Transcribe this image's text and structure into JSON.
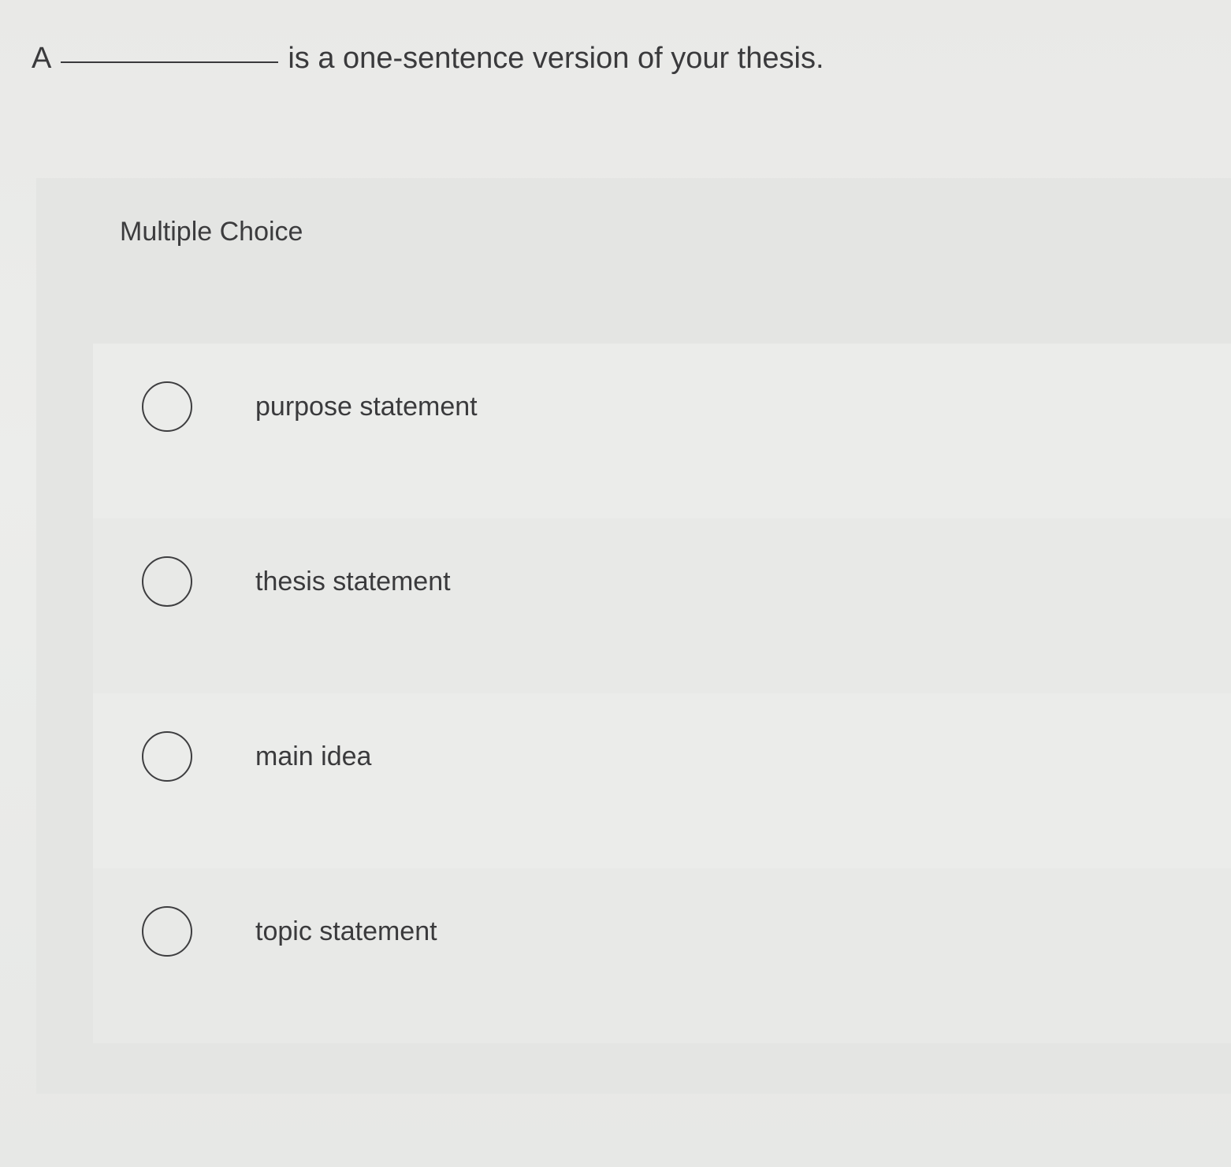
{
  "question": {
    "prefix": "A",
    "suffix": "is a one-sentence version of your thesis."
  },
  "panel": {
    "title": "Multiple Choice"
  },
  "options": [
    {
      "label": "purpose statement",
      "selected": false
    },
    {
      "label": "thesis statement",
      "selected": false
    },
    {
      "label": "main idea",
      "selected": false
    },
    {
      "label": "topic statement",
      "selected": false
    }
  ]
}
